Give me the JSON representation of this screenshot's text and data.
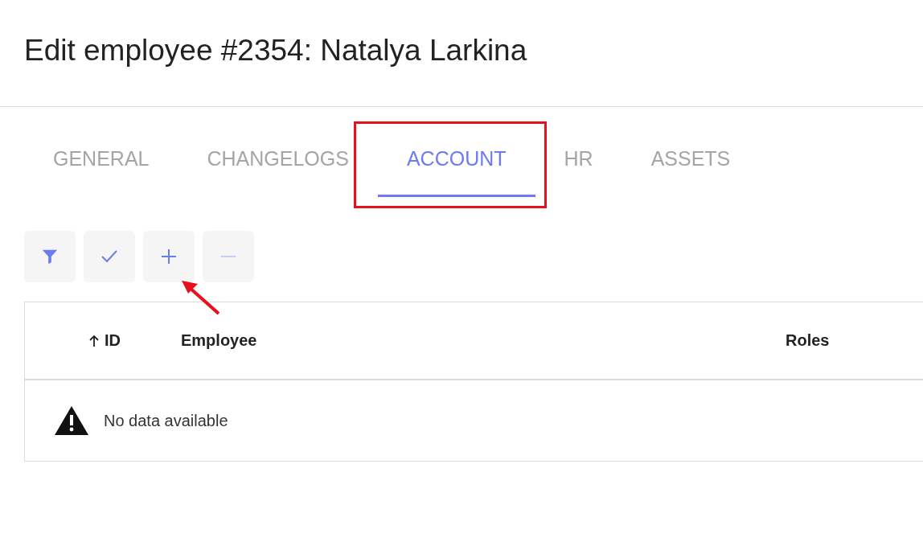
{
  "page_title": "Edit employee #2354: Natalya Larkina",
  "tabs": [
    {
      "label": "GENERAL",
      "selected": false
    },
    {
      "label": "CHANGELOGS",
      "selected": false
    },
    {
      "label": "ACCOUNT",
      "selected": true
    },
    {
      "label": "HR",
      "selected": false
    },
    {
      "label": "ASSETS",
      "selected": false
    }
  ],
  "toolbar": [
    {
      "kind": "filter",
      "disabled": false
    },
    {
      "kind": "check",
      "disabled": false
    },
    {
      "kind": "add",
      "disabled": false
    },
    {
      "kind": "remove",
      "disabled": true
    }
  ],
  "table": {
    "columns": [
      {
        "label": "ID",
        "sorted": true
      },
      {
        "label": "Employee",
        "sorted": false
      },
      {
        "label": "Roles",
        "sorted": false
      }
    ],
    "empty_message": "No data available"
  }
}
